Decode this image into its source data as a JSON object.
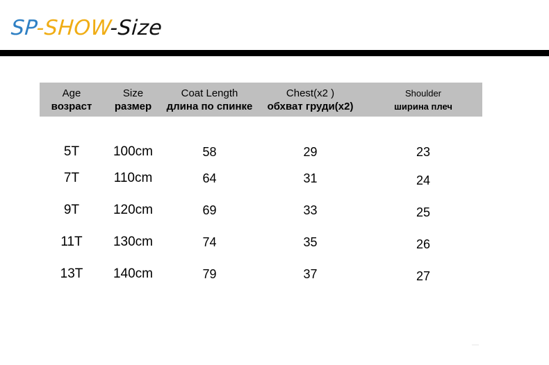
{
  "brand": {
    "segment_blue": "SP",
    "segment_gold": "-SHOW",
    "segment_black": "-Size"
  },
  "colors": {
    "brand_blue": "#2f80c4",
    "brand_gold": "#f0ad15",
    "brand_black": "#111111",
    "divider_bar": "#000000",
    "header_band": "#bfbfbf",
    "text": "#000000",
    "page_background": "#ffffff"
  },
  "table": {
    "columns": [
      {
        "en": "Age",
        "ru": "возраст"
      },
      {
        "en": "Size",
        "ru": "размер"
      },
      {
        "en": "Coat Length",
        "ru": "длина по спинке"
      },
      {
        "en": "Chest(x2 )",
        "ru": "обхват груди(x2)"
      },
      {
        "en": "Shoulder",
        "ru": "ширина плеч"
      }
    ],
    "rows": [
      {
        "age": "5T",
        "size": "100cm",
        "coat_length": "58",
        "chest": "29",
        "shoulder": "23"
      },
      {
        "age": "7T",
        "size": "110cm",
        "coat_length": "64",
        "chest": "31",
        "shoulder": "24"
      },
      {
        "age": "9T",
        "size": "120cm",
        "coat_length": "69",
        "chest": "33",
        "shoulder": "25"
      },
      {
        "age": "11T",
        "size": "130cm",
        "coat_length": "74",
        "chest": "35",
        "shoulder": "26"
      },
      {
        "age": "13T",
        "size": "140cm",
        "coat_length": "79",
        "chest": "37",
        "shoulder": "27"
      }
    ]
  }
}
